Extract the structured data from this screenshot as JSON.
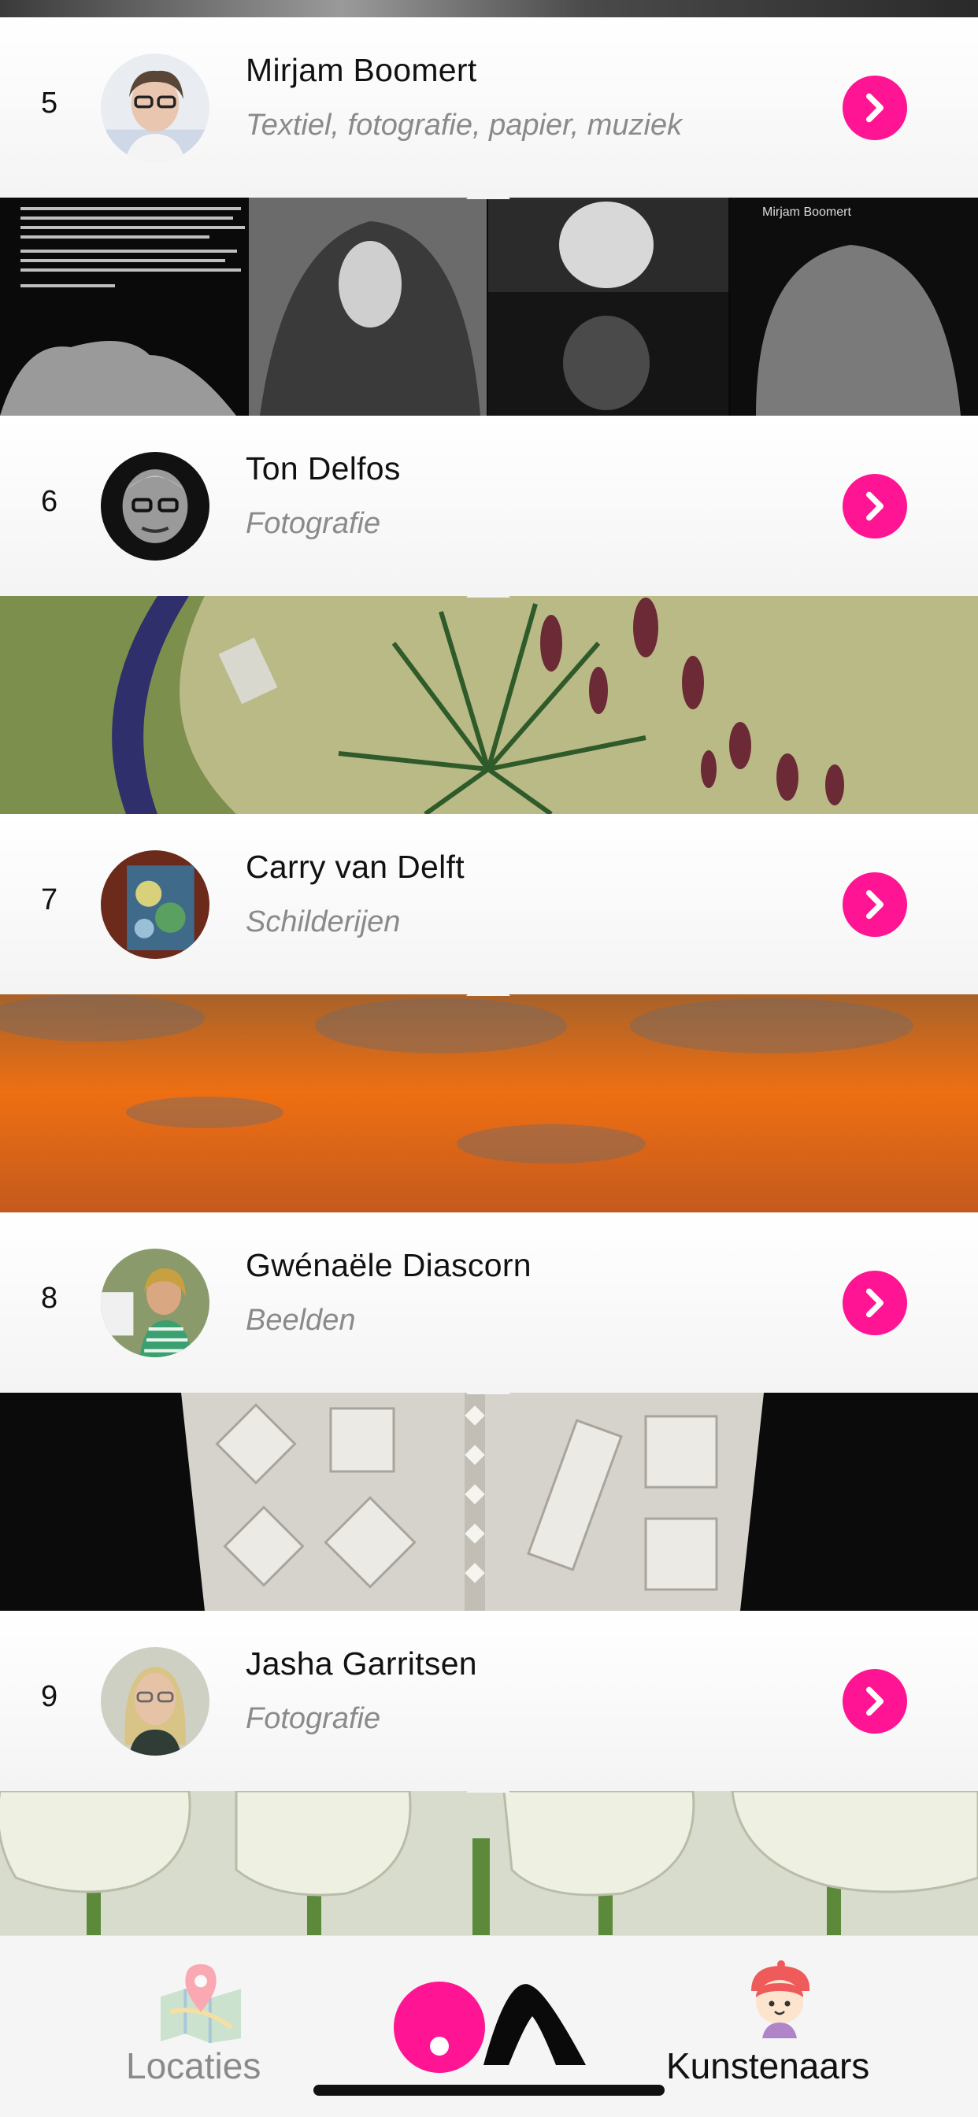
{
  "artists": [
    {
      "number": "5",
      "name": "Mirjam Boomert",
      "discipline": "Textiel, fotografie, papier, muziek"
    },
    {
      "number": "6",
      "name": "Ton Delfos",
      "discipline": "Fotografie"
    },
    {
      "number": "7",
      "name": "Carry van Delft",
      "discipline": "Schilderijen"
    },
    {
      "number": "8",
      "name": "Gwénaële Diascorn",
      "discipline": "Beelden"
    },
    {
      "number": "9",
      "name": "Jasha Garritsen",
      "discipline": "Fotografie"
    }
  ],
  "banner_caption": "Mirjam Boomert",
  "tabbar": {
    "left_label": "Locaties",
    "right_label": "Kunstenaars"
  },
  "colors": {
    "accent": "#ff1493",
    "inactive_text": "#8a8a8a",
    "active_text": "#111111"
  },
  "icons": {
    "arrow": "chevron-right-icon",
    "map": "map-icon",
    "logo": "app-logo-icon",
    "artist": "artist-avatar-icon"
  }
}
